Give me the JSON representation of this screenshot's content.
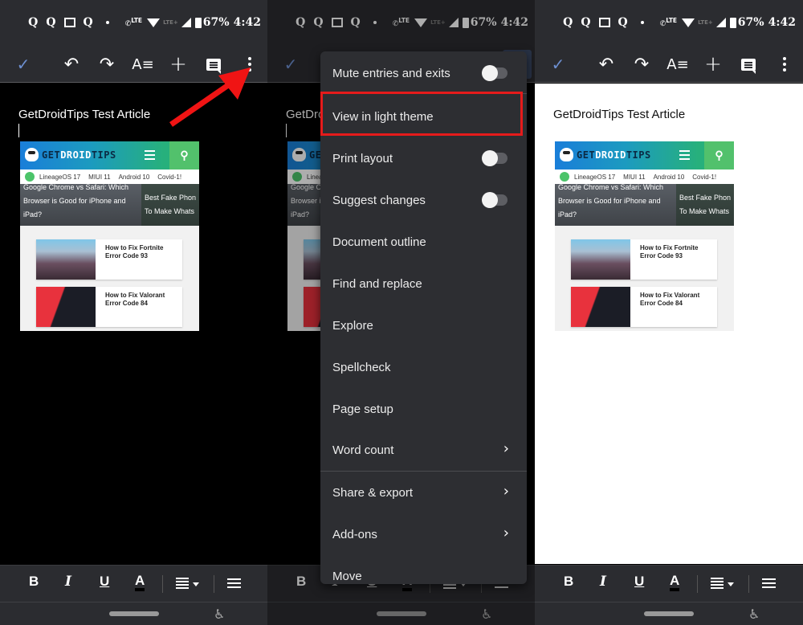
{
  "status_bar": {
    "notification_icons": [
      "Q",
      "Q",
      "mail-icon",
      "Q",
      "dot-icon"
    ],
    "call_badge": "LTE",
    "lte_badge": "LTE+",
    "battery": "67%",
    "time": "4:42"
  },
  "toolbar": {
    "check_icon": "✓",
    "undo_icon": "↶",
    "redo_icon": "↷",
    "format_icon": "A≡",
    "insert_icon": "+",
    "comment_icon": "comment-icon",
    "more_icon": "more-vertical-icon"
  },
  "document": {
    "title": "GetDroidTips Test Article",
    "embedded_image": {
      "logo_prefix": "GET",
      "logo_bold": "DROID",
      "logo_suffix": "TIPS",
      "search_icon": "⚲",
      "tags": [
        "LineageOS 17",
        "MIUI 11",
        "Android 10",
        "Covid-1!"
      ],
      "featured": [
        {
          "lines": [
            "Google Chrome vs Safari: Which",
            "Browser is Good for iPhone and",
            "iPad?"
          ]
        },
        {
          "lines": [
            "Best Fake Phon",
            "To Make Whats"
          ]
        }
      ],
      "cards": [
        {
          "title": "How to Fix Fortnite Error Code 93"
        },
        {
          "title": "How to Fix Valorant Error Code 84"
        }
      ]
    }
  },
  "menu": {
    "items": [
      {
        "label": "Mute entries and exits",
        "control": "toggle",
        "on": false
      },
      {
        "label": "View in light theme",
        "control": "none",
        "highlighted": true
      },
      {
        "label": "Print layout",
        "control": "toggle",
        "on": false
      },
      {
        "label": "Suggest changes",
        "control": "toggle",
        "on": false
      },
      {
        "label": "Document outline",
        "control": "none"
      },
      {
        "label": "Find and replace",
        "control": "none"
      },
      {
        "label": "Explore",
        "control": "none"
      },
      {
        "label": "Spellcheck",
        "control": "none"
      },
      {
        "label": "Page setup",
        "control": "none"
      },
      {
        "label": "Word count",
        "control": "chevron"
      },
      {
        "label": "Share & export",
        "control": "chevron"
      },
      {
        "label": "Add-ons",
        "control": "chevron"
      },
      {
        "label": "Move",
        "control": "none"
      }
    ],
    "chevron_glyph": "›"
  },
  "format_bar": {
    "bold": "B",
    "italic": "I",
    "underline": "U",
    "text_color": "A",
    "align_icon": "align-left-icon",
    "list_icon": "bulleted-list-icon"
  },
  "nav_bar": {
    "accessibility_icon": "♿"
  },
  "colors": {
    "toolbar_bg": "#2b2c30",
    "menu_bg": "#2d2e32",
    "highlight_red": "#e51b1b",
    "check_blue": "#6d8fd0",
    "arrow_red": "#f01414"
  }
}
